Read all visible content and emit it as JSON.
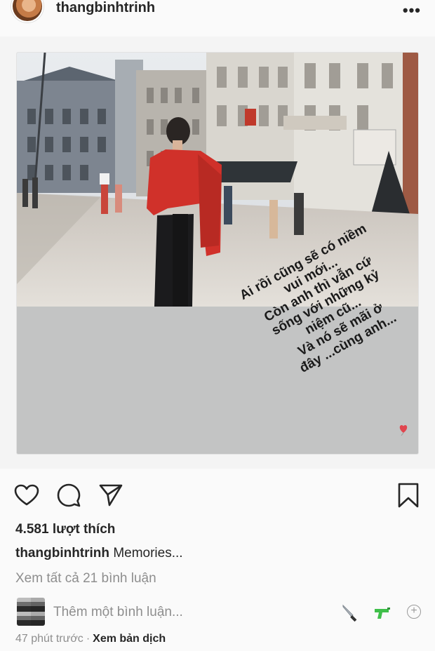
{
  "post": {
    "username": "thangbinhtrinh",
    "likes": "4.581 lượt thích",
    "caption_user": "thangbinhtrinh",
    "caption_text": "Memories...",
    "view_comments": "Xem tất cả 21 bình luận",
    "comment_placeholder": "Thêm một bình luận...",
    "time_ago": "47 phút trước",
    "separator": "·",
    "translate": "Xem bản dịch"
  },
  "story": {
    "lines": [
      "Ai rồi cũng sẽ có niềm",
      "vui mới...",
      "Còn anh thì vẫn cứ",
      "sống với những kỷ",
      "niệm cũ...",
      "Và nó sẽ mãi ở",
      "đây ...cùng anh..."
    ]
  },
  "icons": {
    "more": "more-icon",
    "like": "heart-icon",
    "comment": "comment-icon",
    "share": "paper-plane-icon",
    "save": "bookmark-icon",
    "emoji_1": "knife-emoji",
    "emoji_2": "water-pistol-emoji",
    "add": "add-emoji-icon"
  },
  "colors": {
    "text": "#262626",
    "secondary": "#8e8e8e",
    "story_background": "#c3c4c4",
    "jacket": "#d0312a"
  }
}
